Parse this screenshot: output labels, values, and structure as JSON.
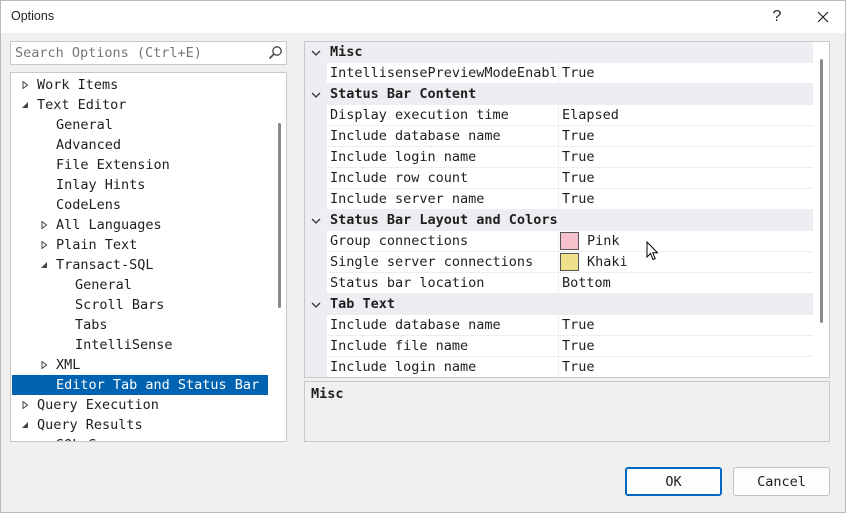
{
  "window": {
    "title": "Options"
  },
  "titlebar": {
    "help_label": "?"
  },
  "search": {
    "placeholder": "Search Options (Ctrl+E)"
  },
  "tree": {
    "items": [
      {
        "label": "Work Items",
        "level": 0,
        "state": "collapsed"
      },
      {
        "label": "Text Editor",
        "level": 0,
        "state": "expanded"
      },
      {
        "label": "General",
        "level": 1,
        "state": "leaf"
      },
      {
        "label": "Advanced",
        "level": 1,
        "state": "leaf"
      },
      {
        "label": "File Extension",
        "level": 1,
        "state": "leaf"
      },
      {
        "label": "Inlay Hints",
        "level": 1,
        "state": "leaf"
      },
      {
        "label": "CodeLens",
        "level": 1,
        "state": "leaf"
      },
      {
        "label": "All Languages",
        "level": 1,
        "state": "collapsed"
      },
      {
        "label": "Plain Text",
        "level": 1,
        "state": "collapsed"
      },
      {
        "label": "Transact-SQL",
        "level": 1,
        "state": "expanded"
      },
      {
        "label": "General",
        "level": 2,
        "state": "leaf"
      },
      {
        "label": "Scroll Bars",
        "level": 2,
        "state": "leaf"
      },
      {
        "label": "Tabs",
        "level": 2,
        "state": "leaf"
      },
      {
        "label": "IntelliSense",
        "level": 2,
        "state": "leaf"
      },
      {
        "label": "XML",
        "level": 1,
        "state": "collapsed"
      },
      {
        "label": "Editor Tab and Status Bar",
        "level": 1,
        "state": "leaf",
        "selected": true
      },
      {
        "label": "Query Execution",
        "level": 0,
        "state": "collapsed"
      },
      {
        "label": "Query Results",
        "level": 0,
        "state": "expanded"
      },
      {
        "label": "SQL Server",
        "level": 1,
        "state": "leaf"
      }
    ]
  },
  "grid": {
    "rows": [
      {
        "type": "category",
        "label": "Misc"
      },
      {
        "type": "prop",
        "name": "IntellisensePreviewModeEnabled",
        "value": "True"
      },
      {
        "type": "category",
        "label": "Status Bar Content"
      },
      {
        "type": "prop",
        "name": "Display execution time",
        "value": "Elapsed"
      },
      {
        "type": "prop",
        "name": "Include database name",
        "value": "True"
      },
      {
        "type": "prop",
        "name": "Include login name",
        "value": "True"
      },
      {
        "type": "prop",
        "name": "Include row count",
        "value": "True"
      },
      {
        "type": "prop",
        "name": "Include server name",
        "value": "True"
      },
      {
        "type": "category",
        "label": "Status Bar Layout and Colors"
      },
      {
        "type": "prop",
        "name": "Group connections",
        "value": "Pink",
        "swatch": "#f7c1cb"
      },
      {
        "type": "prop",
        "name": "Single server connections",
        "value": "Khaki",
        "swatch": "#efe08c"
      },
      {
        "type": "prop",
        "name": "Status bar location",
        "value": "Bottom"
      },
      {
        "type": "category",
        "label": "Tab Text"
      },
      {
        "type": "prop",
        "name": "Include database name",
        "value": "True"
      },
      {
        "type": "prop",
        "name": "Include file name",
        "value": "True"
      },
      {
        "type": "prop",
        "name": "Include login name",
        "value": "True"
      }
    ]
  },
  "description": {
    "title": "Misc"
  },
  "buttons": {
    "ok": "OK",
    "cancel": "Cancel"
  },
  "colors": {
    "selection": "#0063b1",
    "category_bg": "#eeeef2",
    "accent": "#0067c0"
  }
}
